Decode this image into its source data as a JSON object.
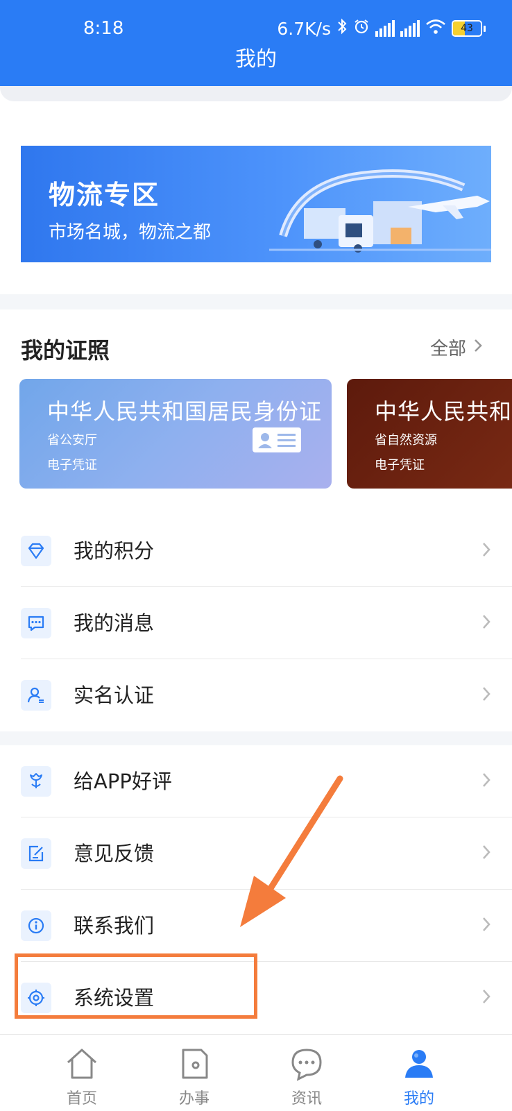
{
  "status": {
    "time": "8:18",
    "speed": "6.7K/s",
    "battery": "43"
  },
  "header": {
    "title": "我的"
  },
  "banner": {
    "title": "物流专区",
    "subtitle": "市场名城，物流之都"
  },
  "certs": {
    "section_title": "我的证照",
    "all_label": "全部",
    "items": [
      {
        "name": "中华人民共和国居民身份证",
        "org": "省公安厅",
        "type": "电子凭证"
      },
      {
        "name": "中华人民共和",
        "org": "省自然资源",
        "type": "电子凭证"
      }
    ]
  },
  "menu": {
    "group1": [
      {
        "label": "我的积分",
        "icon": "diamond-icon"
      },
      {
        "label": "我的消息",
        "icon": "message-icon"
      },
      {
        "label": "实名认证",
        "icon": "user-verify-icon"
      }
    ],
    "group2": [
      {
        "label": "给APP好评",
        "icon": "flower-icon"
      },
      {
        "label": "意见反馈",
        "icon": "edit-icon"
      },
      {
        "label": "联系我们",
        "icon": "info-icon"
      },
      {
        "label": "系统设置",
        "icon": "settings-icon"
      }
    ]
  },
  "tabs": [
    {
      "label": "首页",
      "icon": "home-icon"
    },
    {
      "label": "办事",
      "icon": "document-icon"
    },
    {
      "label": "资讯",
      "icon": "chat-icon"
    },
    {
      "label": "我的",
      "icon": "profile-icon",
      "active": true
    }
  ],
  "colors": {
    "primary": "#2a7cf5",
    "annotation": "#f47c3c",
    "cert2": "#6b2211"
  }
}
